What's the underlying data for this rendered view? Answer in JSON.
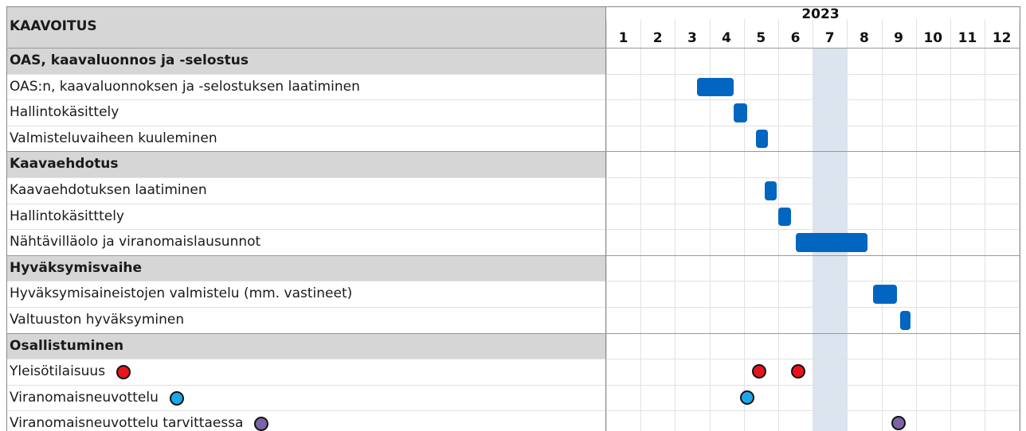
{
  "header": {
    "title": "KAAVOITUS",
    "year": "2023"
  },
  "months": [
    "1",
    "2",
    "3",
    "4",
    "5",
    "6",
    "7",
    "8",
    "9",
    "10",
    "11",
    "12"
  ],
  "rows": [
    {
      "label": "OAS, kaavaluonnos ja -selostus",
      "type": "section"
    },
    {
      "label": "OAS:n, kaavaluonnoksen ja -selostuksen laatiminen",
      "type": "task"
    },
    {
      "label": "Hallintokäsittely",
      "type": "task"
    },
    {
      "label": "Valmisteluvaiheen kuuleminen",
      "type": "task"
    },
    {
      "label": "Kaavaehdotus",
      "type": "section"
    },
    {
      "label": "Kaavaehdotuksen laatiminen",
      "type": "task"
    },
    {
      "label": "Hallintokäsitttely",
      "type": "task"
    },
    {
      "label": "Nähtävilläolo ja viranomaislausunnot",
      "type": "task"
    },
    {
      "label": "Hyväksymisvaihe",
      "type": "section"
    },
    {
      "label": "Hyväksymisaineistojen valmistelu (mm. vastineet)",
      "type": "task"
    },
    {
      "label": "Valtuuston hyväksyminen",
      "type": "task"
    },
    {
      "label": "Osallistuminen",
      "type": "section"
    },
    {
      "label": "Yleisötilaisuus",
      "type": "legend",
      "legend_color": "#e8141b"
    },
    {
      "label": "Viranomaisneuvottelu",
      "type": "legend",
      "legend_color": "#1ba7e8"
    },
    {
      "label": "Viranomaisneuvottelu tarvittaessa",
      "type": "legend",
      "legend_color": "#7b63a6"
    }
  ],
  "chart_data": {
    "type": "gantt",
    "title": "KAAVOITUS",
    "year": "2023",
    "x_unit": "month",
    "x_range": [
      1,
      13
    ],
    "highlight_month": 7,
    "highlight_color": "#dbe4ef",
    "bar_color": "#0066c0",
    "tasks": [
      {
        "name": "OAS:n, kaavaluonnoksen ja -selostuksen laatiminen",
        "start": 3.65,
        "end": 4.7
      },
      {
        "name": "Hallintokäsittely",
        "start": 4.7,
        "end": 5.1
      },
      {
        "name": "Valmisteluvaiheen kuuleminen",
        "start": 5.35,
        "end": 5.7
      },
      {
        "name": "Kaavaehdotuksen laatiminen",
        "start": 5.6,
        "end": 5.95
      },
      {
        "name": "Hallintokäsitttely",
        "start": 6.0,
        "end": 6.38
      },
      {
        "name": "Nähtävilläolo ja viranomaislausunnot",
        "start": 6.52,
        "end": 8.6
      },
      {
        "name": "Hyväksymisaineistojen valmistelu (mm. vastineet)",
        "start": 8.75,
        "end": 9.45
      },
      {
        "name": "Valtuuston hyväksyminen",
        "start": 9.55,
        "end": 9.85
      }
    ],
    "events": [
      {
        "name": "Yleisötilaisuus",
        "month": 5.45,
        "color": "#e8141b"
      },
      {
        "name": "Yleisötilaisuus",
        "month": 6.58,
        "color": "#e8141b"
      },
      {
        "name": "Viranomaisneuvottelu",
        "month": 5.1,
        "color": "#1ba7e8"
      },
      {
        "name": "Viranomaisneuvottelu tarvittaessa",
        "month": 9.5,
        "color": "#7b63a6"
      }
    ]
  }
}
